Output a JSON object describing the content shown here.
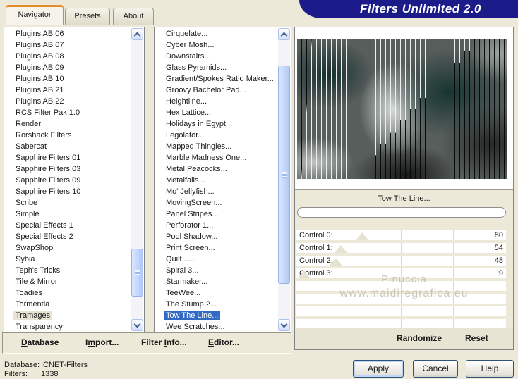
{
  "title": "Filters Unlimited 2.0",
  "tabs": [
    {
      "label": "Navigator",
      "active": true
    },
    {
      "label": "Presets",
      "active": false
    },
    {
      "label": "About",
      "active": false
    }
  ],
  "category_list": {
    "items": [
      {
        "label": "Plugins AB 06"
      },
      {
        "label": "Plugins AB 07"
      },
      {
        "label": "Plugins AB 08"
      },
      {
        "label": "Plugins AB 09"
      },
      {
        "label": "Plugins AB 10"
      },
      {
        "label": "Plugins AB 21"
      },
      {
        "label": "Plugins AB 22"
      },
      {
        "label": "RCS Filter Pak 1.0"
      },
      {
        "label": "Render"
      },
      {
        "label": "Rorshack Filters"
      },
      {
        "label": "Sabercat"
      },
      {
        "label": "Sapphire Filters 01"
      },
      {
        "label": "Sapphire Filters 03"
      },
      {
        "label": "Sapphire Filters 09"
      },
      {
        "label": "Sapphire Filters 10"
      },
      {
        "label": "Scribe"
      },
      {
        "label": "Simple"
      },
      {
        "label": "Special Effects 1"
      },
      {
        "label": "Special Effects 2"
      },
      {
        "label": "SwapShop"
      },
      {
        "label": "Sybia"
      },
      {
        "label": "Teph's Tricks"
      },
      {
        "label": "Tile & Mirror"
      },
      {
        "label": "Toadies"
      },
      {
        "label": "Tormentia"
      },
      {
        "label": "Tramages",
        "selected": true
      },
      {
        "label": "Transparency"
      }
    ]
  },
  "filter_list": {
    "items": [
      {
        "label": "Cirquelate..."
      },
      {
        "label": "Cyber Mosh..."
      },
      {
        "label": "Downstairs..."
      },
      {
        "label": "Glass Pyramids..."
      },
      {
        "label": "Gradient/Spokes Ratio Maker..."
      },
      {
        "label": "Groovy Bachelor Pad..."
      },
      {
        "label": "Heightline..."
      },
      {
        "label": "Hex Lattice..."
      },
      {
        "label": "Holidays in Egypt..."
      },
      {
        "label": "Legolator..."
      },
      {
        "label": "Mapped Thingies..."
      },
      {
        "label": "Marble Madness One..."
      },
      {
        "label": "Metal Peacocks..."
      },
      {
        "label": "Metalfalls..."
      },
      {
        "label": "Mo' Jellyfish..."
      },
      {
        "label": "MovingScreen..."
      },
      {
        "label": "Panel Stripes..."
      },
      {
        "label": "Perforator 1..."
      },
      {
        "label": "Pool Shadow..."
      },
      {
        "label": "Print Screen..."
      },
      {
        "label": "Quilt......"
      },
      {
        "label": "Spiral 3..."
      },
      {
        "label": "Starmaker..."
      },
      {
        "label": "TeeWee..."
      },
      {
        "label": "The Stump 2..."
      },
      {
        "label": "Tow The Line...",
        "selected": true
      },
      {
        "label": "Wee Scratches..."
      }
    ]
  },
  "preview": {
    "selected_filter": "Tow The Line...",
    "watermark_line1": "Pinuccia",
    "watermark_line2": "www.maidiregrafica.eu"
  },
  "controls": {
    "rows": [
      {
        "label": "Control 0:",
        "value": 80,
        "max": 255
      },
      {
        "label": "Control 1:",
        "value": 54,
        "max": 255
      },
      {
        "label": "Control 2:",
        "value": 48,
        "max": 255
      },
      {
        "label": "Control 3:",
        "value": 9,
        "max": 255
      },
      {
        "label": ""
      },
      {
        "label": ""
      },
      {
        "label": ""
      },
      {
        "label": ""
      }
    ]
  },
  "panel_buttons": {
    "randomize": "Randomize",
    "reset": "Reset"
  },
  "menu": {
    "items": [
      {
        "label": "Database",
        "accel": "D"
      },
      {
        "label": "Import...",
        "accel": "m"
      },
      {
        "label": "Filter Info...",
        "accel": "I"
      },
      {
        "label": "Editor...",
        "accel": "E"
      }
    ]
  },
  "status": {
    "database_label": "Database:",
    "database_value": "ICNET-Filters",
    "filters_label": "Filters:",
    "filters_value": "1338"
  },
  "dialog_buttons": {
    "apply": "Apply",
    "cancel": "Cancel",
    "help": "Help"
  },
  "colors": {
    "title_bar": "#1B1B8A",
    "active_selection": "#316AC5",
    "inactive_selection": "#E8E4D4",
    "tab_accent": "#E68B2C",
    "dialog_bg": "#ECE9D8"
  }
}
